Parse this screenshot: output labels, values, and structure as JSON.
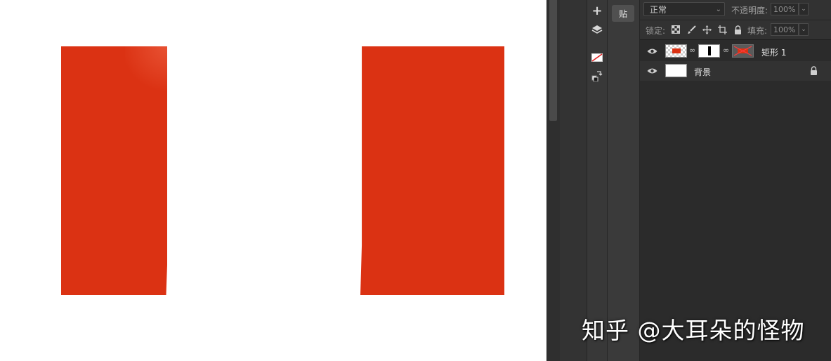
{
  "canvas": {
    "background": "#ffffff",
    "shape_color": "#db3213"
  },
  "docked_panel": {
    "paste_label": "贴"
  },
  "tools": {
    "items": [
      "add-icon",
      "layers-icon",
      "color-swatch-icon",
      "swap-colors-icon"
    ]
  },
  "layers_panel": {
    "blend_mode": "正常",
    "opacity_label": "不透明度:",
    "opacity_value": "100%",
    "lock_label": "锁定:",
    "fill_label": "填充:",
    "fill_value": "100%",
    "layers": [
      {
        "name": "矩形 1",
        "visible": true
      },
      {
        "name": "背景",
        "visible": true,
        "locked": true
      }
    ]
  },
  "watermark": {
    "text": "知乎 @大耳朵的怪物"
  }
}
